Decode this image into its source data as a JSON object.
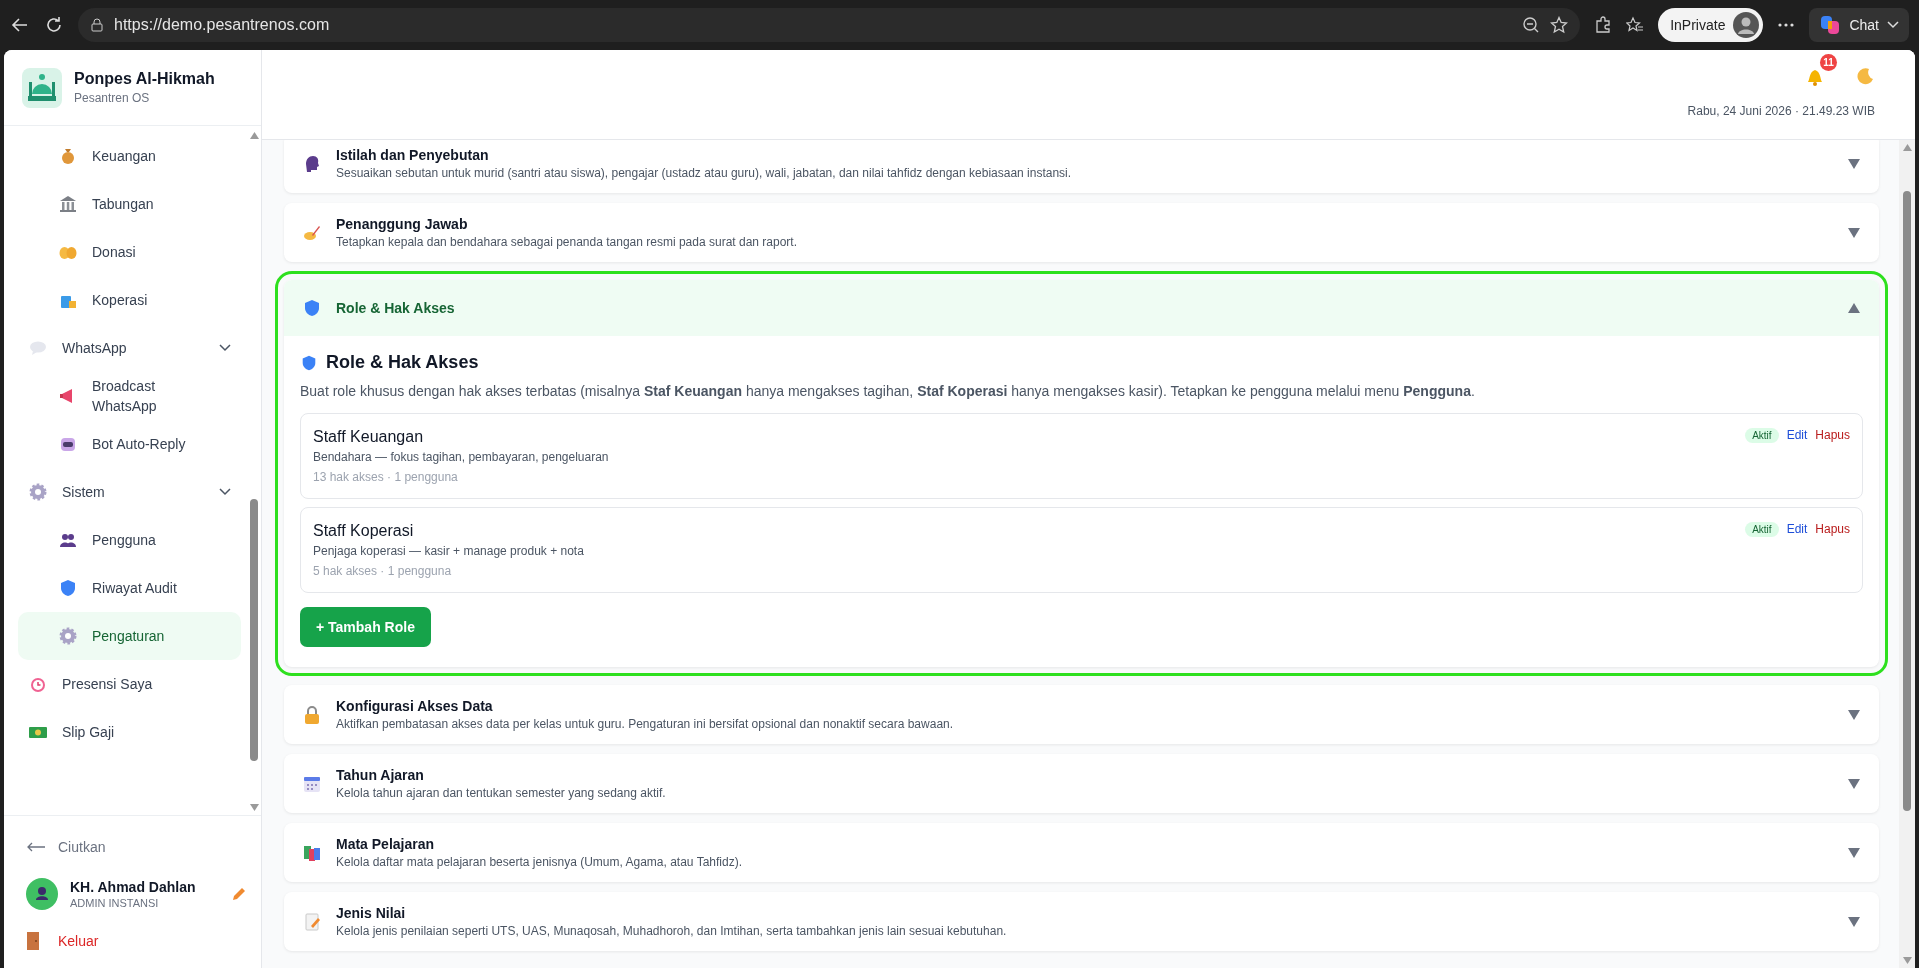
{
  "browser": {
    "url": "https://demo.pesantrenos.com",
    "profile": "InPrivate",
    "chat": "Chat"
  },
  "brand": {
    "name": "Ponpes Al-Hikmah",
    "subtitle": "Pesantren OS"
  },
  "sidebar": {
    "items": [
      {
        "children": [
          {
            "label": "Keuangan",
            "selected": false
          },
          {
            "label": "Tabungan",
            "selected": false
          },
          {
            "label": "Donasi",
            "selected": false
          },
          {
            "label": "Koperasi",
            "selected": false
          }
        ]
      },
      {
        "label": "WhatsApp",
        "selected": false,
        "expanded": true,
        "children": [
          {
            "label": "Broadcast WhatsApp",
            "selected": false
          },
          {
            "label": "Bot Auto-Reply",
            "selected": false
          }
        ]
      },
      {
        "label": "Sistem",
        "selected": false,
        "expanded": true,
        "children": [
          {
            "label": "Pengguna",
            "selected": false
          },
          {
            "label": "Riwayat Audit",
            "selected": false
          },
          {
            "label": "Pengaturan",
            "selected": true
          }
        ]
      },
      {
        "label": "Presensi Saya",
        "selected": false
      },
      {
        "label": "Slip Gaji",
        "selected": false
      }
    ],
    "collapse": "Ciutkan",
    "user": {
      "name": "KH. Ahmad Dahlan",
      "role": "ADMIN INSTANSI"
    },
    "logout": "Keluar"
  },
  "header": {
    "notifications": "11",
    "datetime": "Rabu, 24 Juni 2026 · 21.49.23 WIB"
  },
  "sections": [
    {
      "title": "Istilah dan Penyebutan",
      "description": "Sesuaikan sebutan untuk murid (santri atau siswa), pengajar (ustadz atau guru), wali, jabatan, dan nilai tahfidz dengan kebiasaan instansi.",
      "expanded": false
    },
    {
      "title": "Penanggung Jawab",
      "description": "Tetapkan kepala dan bendahara sebagai penanda tangan resmi pada surat dan raport.",
      "expanded": false
    },
    {
      "title": "Role & Hak Akses",
      "expanded": true,
      "content": {
        "heading": "Role & Hak Akses",
        "description": "Buat role khusus dengan hak akses terbatas (misalnya **Staf Keuangan** hanya mengakses tagihan, **Staf Koperasi** hanya mengakses kasir). Tetapkan ke pengguna melalui menu **Pengguna**.",
        "roles": [
          {
            "name": "Staff Keuangan",
            "description": "Bendahara — fokus tagihan, pembayaran, pengeluaran",
            "meta": "13 hak akses · 1 pengguna",
            "status": "Aktif",
            "edit": "Edit",
            "delete": "Hapus"
          },
          {
            "name": "Staff Koperasi",
            "description": "Penjaga koperasi — kasir + manage produk + nota",
            "meta": "5 hak akses · 1 pengguna",
            "status": "Aktif",
            "edit": "Edit",
            "delete": "Hapus"
          }
        ],
        "add_button": "+ Tambah Role"
      }
    },
    {
      "title": "Konfigurasi Akses Data",
      "description": "Aktifkan pembatasan akses data per kelas untuk guru. Pengaturan ini bersifat opsional dan nonaktif secara bawaan.",
      "expanded": false
    },
    {
      "title": "Tahun Ajaran",
      "description": "Kelola tahun ajaran dan tentukan semester yang sedang aktif.",
      "expanded": false
    },
    {
      "title": "Mata Pelajaran",
      "description": "Kelola daftar mata pelajaran beserta jenisnya (Umum, Agama, atau Tahfidz).",
      "expanded": false
    },
    {
      "title": "Jenis Nilai",
      "description": "Kelola jenis penilaian seperti UTS, UAS, Munaqosah, Muhadhoroh, dan Imtihan, serta tambahkan jenis lain sesuai kebutuhan.",
      "expanded": false
    }
  ]
}
